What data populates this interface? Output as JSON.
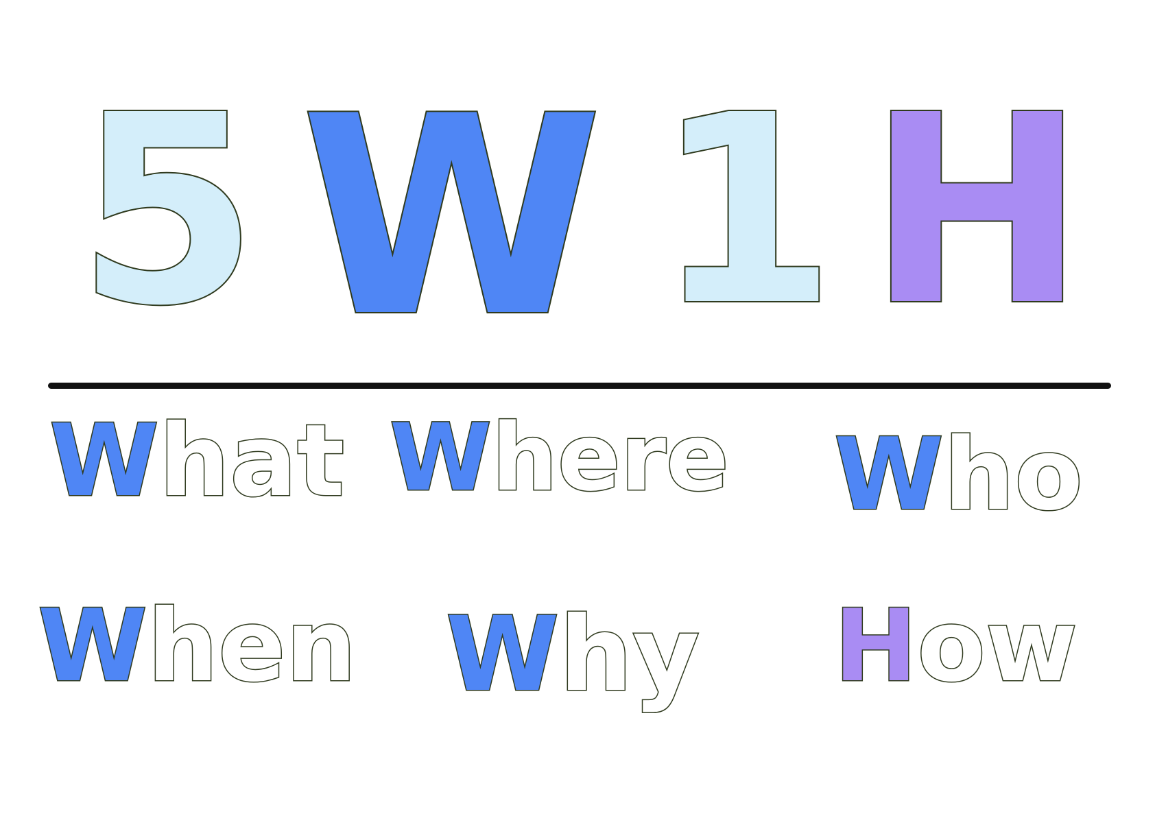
{
  "title": {
    "letters": [
      "5",
      "W",
      "1",
      "H"
    ]
  },
  "colors": {
    "light_blue": "#d4eefa",
    "blue": "#4f86f5",
    "purple": "#a98cf3",
    "outline": "#2f3a1e",
    "divider": "#111111"
  },
  "words": {
    "what": {
      "initial": "W",
      "rest": "hat"
    },
    "where": {
      "initial": "W",
      "rest": "here"
    },
    "who": {
      "initial": "W",
      "rest": "ho"
    },
    "when": {
      "initial": "W",
      "rest": "hen"
    },
    "why": {
      "initial": "W",
      "rest": "hy"
    },
    "how": {
      "initial": "H",
      "rest": "ow"
    }
  }
}
